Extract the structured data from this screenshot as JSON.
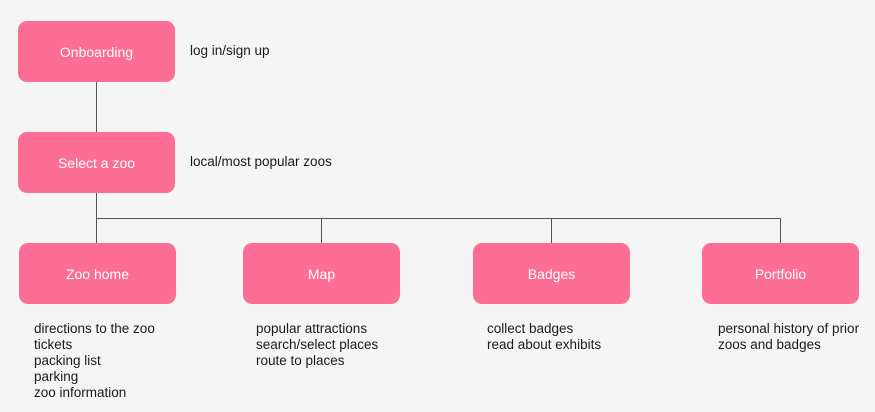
{
  "nodes": {
    "onboarding": {
      "label": "Onboarding",
      "note": "log in/sign up"
    },
    "select_zoo": {
      "label": "Select a zoo",
      "note": "local/most popular zoos"
    },
    "zoo_home": {
      "label": "Zoo home",
      "details": [
        "directions to the zoo",
        "tickets",
        "packing list",
        "parking",
        "zoo information"
      ]
    },
    "map": {
      "label": "Map",
      "details": [
        "popular attractions",
        "search/select places",
        "route to places"
      ]
    },
    "badges": {
      "label": "Badges",
      "details": [
        "collect badges",
        "read about exhibits"
      ]
    },
    "portfolio": {
      "label": "Portfolio",
      "details": [
        "personal history of prior",
        "zoos and badges"
      ]
    }
  },
  "colors": {
    "node_fill": "#fd6e96",
    "node_text": "#ffffff",
    "connector": "#555555",
    "background": "#f5f5f5"
  }
}
